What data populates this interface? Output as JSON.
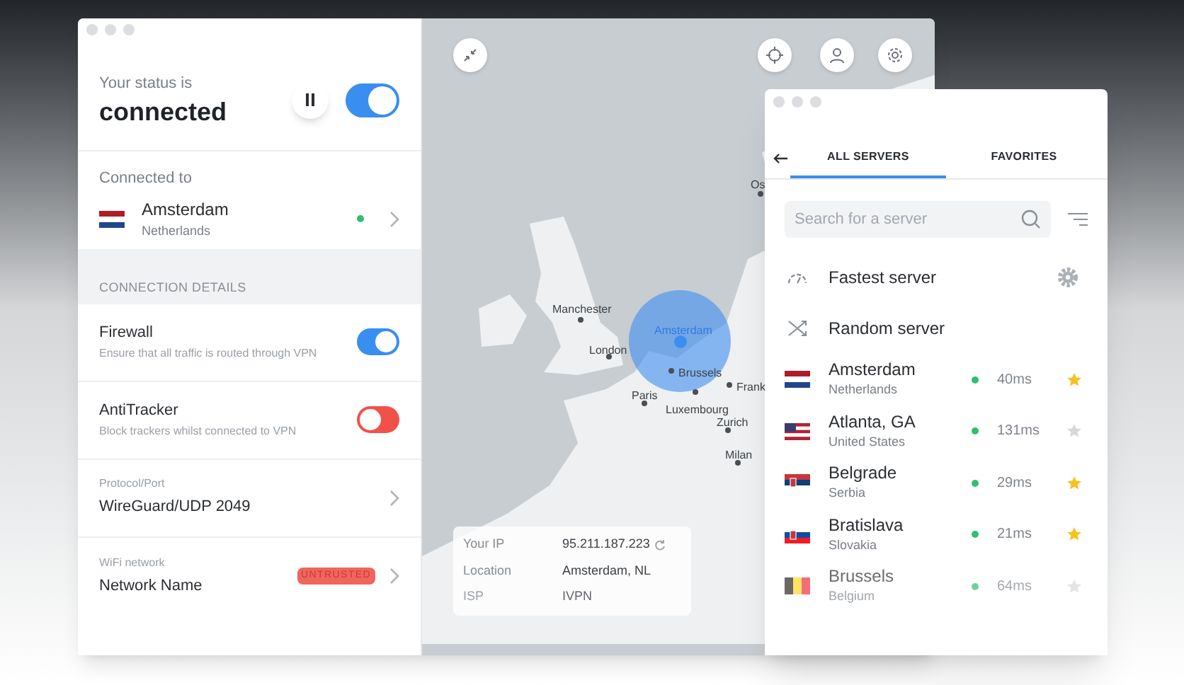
{
  "status": {
    "label": "Your status is",
    "value": "connected",
    "paused": false,
    "on": true
  },
  "connection": {
    "label": "Connected to",
    "city": "Amsterdam",
    "country": "Netherlands",
    "kind": "nl"
  },
  "section_title": "CONNECTION DETAILS",
  "toggles": [
    {
      "title": "Firewall",
      "description": "Ensure that all traffic is routed through VPN",
      "on": true
    },
    {
      "title": "AntiTracker",
      "description": "Block trackers whilst connected to VPN",
      "on": false
    }
  ],
  "settings": [
    {
      "label": "Protocol/Port",
      "value": "WireGuard/UDP 2049"
    },
    {
      "label": "WiFi network",
      "value": "Network Name",
      "badge": "UNTRUSTED"
    }
  ],
  "map": {
    "cities": [
      {
        "name": "Os",
        "kind": "city"
      },
      {
        "name": "Manchester",
        "kind": "city"
      },
      {
        "name": "London",
        "kind": "city"
      },
      {
        "name": "Amsterdam",
        "kind": "current"
      },
      {
        "name": "Brussels",
        "kind": "city"
      },
      {
        "name": "Frank",
        "kind": "city"
      },
      {
        "name": "Paris",
        "kind": "city"
      },
      {
        "name": "Luxembourg",
        "kind": "city"
      },
      {
        "name": "Zurich",
        "kind": "city"
      },
      {
        "name": "Milan",
        "kind": "city"
      }
    ]
  },
  "ip_info": [
    {
      "label": "Your IP",
      "value": "95.211.187.223"
    },
    {
      "label": "Location",
      "value": "Amsterdam, NL"
    },
    {
      "label": "ISP",
      "value": "IVPN"
    }
  ],
  "servers_panel": {
    "tabs": [
      {
        "label": "ALL SERVERS",
        "selected": true
      },
      {
        "label": "FAVORITES",
        "selected": false
      }
    ],
    "search": {
      "placeholder": "Search for a server"
    },
    "options": [
      {
        "kind": "fastest",
        "label": "Fastest server"
      },
      {
        "kind": "random",
        "label": "Random server"
      }
    ],
    "servers": [
      {
        "city": "Amsterdam",
        "country": "Netherlands",
        "kind": "nl",
        "ping": "40ms",
        "favorite": true
      },
      {
        "city": "Atlanta, GA",
        "country": "United States",
        "kind": "us",
        "ping": "131ms",
        "favorite": false
      },
      {
        "city": "Belgrade",
        "country": "Serbia",
        "kind": "rs",
        "ping": "29ms",
        "favorite": true
      },
      {
        "city": "Bratislava",
        "country": "Slovakia",
        "kind": "sk",
        "ping": "21ms",
        "favorite": true
      },
      {
        "city": "Brussels",
        "country": "Belgium",
        "kind": "be",
        "ping": "64ms",
        "favorite": false
      }
    ]
  }
}
